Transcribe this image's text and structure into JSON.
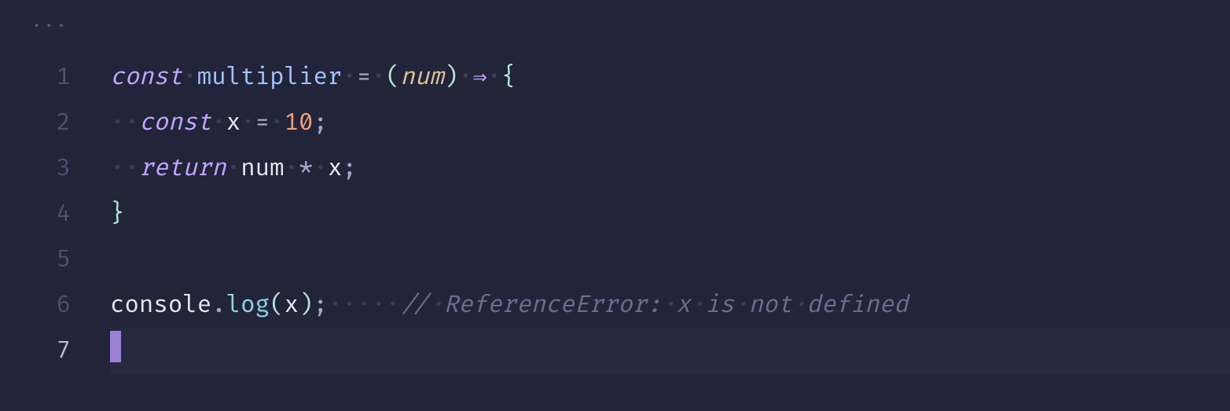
{
  "breadcrumb": {
    "label": "..."
  },
  "gutter": {
    "l1": "1",
    "l2": "2",
    "l3": "3",
    "l4": "4",
    "l5": "5",
    "l6": "6",
    "l7": "7"
  },
  "ws": {
    "dot": "·",
    "dot2": "··",
    "dot5": "·····"
  },
  "code": {
    "l1": {
      "const": "const",
      "id": "multiplier",
      "eq": "=",
      "lp": "(",
      "param": "num",
      "rp": ")",
      "arrow": "⇒",
      "lb": "{"
    },
    "l2": {
      "const": "const",
      "var": "x",
      "eq": "=",
      "num": "10",
      "semi": ";"
    },
    "l3": {
      "return": "return",
      "id": "num",
      "star": "*",
      "var": "x",
      "semi": ";"
    },
    "l4": {
      "rb": "}"
    },
    "l6": {
      "obj": "console",
      "dot": ".",
      "fn": "log",
      "lp": "(",
      "arg": "x",
      "rp": ")",
      "semi": ";",
      "cmt_slash": "//",
      "cmt_txt": "ReferenceError:",
      "cmt_x": "x",
      "cmt_is": "is",
      "cmt_not": "not",
      "cmt_def": "defined"
    }
  }
}
